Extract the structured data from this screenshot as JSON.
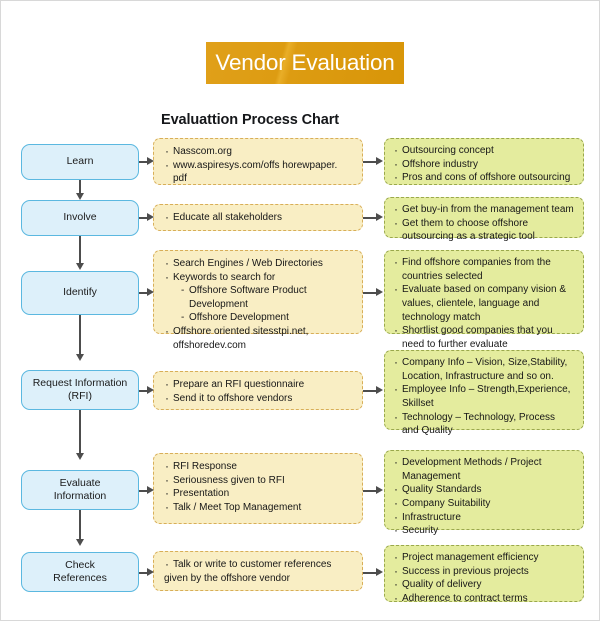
{
  "banner": {
    "title": "Vendor Evaluation",
    "bg_color": "#dd9c12",
    "text_color": "#ffffff"
  },
  "heading": "Evaluattion Process Chart",
  "colors": {
    "stage_fill": "#ddf0fa",
    "stage_border": "#5bb8e0",
    "action_fill": "#f9eec4",
    "action_border": "#d8ae58",
    "outcome_fill": "#e4ec9e",
    "outcome_border": "#9aa84c",
    "connector": "#4d4d4d"
  },
  "rows": [
    {
      "stage": "Learn",
      "actions": [
        "Nasscom.org",
        "www.aspiresys.com/offs horewpaper.",
        "pdf"
      ],
      "outcomes": [
        "Outsourcing concept",
        "Offshore industry",
        "Pros and cons of offshore outsourcing"
      ]
    },
    {
      "stage": "Involve",
      "actions": [
        "Educate all stakeholders"
      ],
      "outcomes": [
        "Get buy-in from the management team",
        "Get them to choose offshore",
        "outsourcing as a strategic tool"
      ]
    },
    {
      "stage": "Identify",
      "actions": [
        "Search Engines / Web Directories",
        "Keywords to search for",
        "Offshore Software Product Development",
        "Offshore Development",
        "Offshore oriented sitesstpi.net,",
        "offshoredev.com"
      ],
      "outcomes": [
        "Find offshore companies from the",
        "countries selected",
        "Evaluate based on company vision &",
        "values, clientele, language and",
        "technology match",
        "Shortlist good companies that you",
        "need to further evaluate"
      ]
    },
    {
      "stage": "Request Information\n(RFI)",
      "stage_line1": "Request Information",
      "stage_line2": "(RFI)",
      "actions": [
        "Prepare an RFI questionnaire",
        "Send it to offshore vendors"
      ],
      "outcomes": [
        "Company Info – Vision, Size,Stability,",
        "Location, Infrastructure and so on.",
        "Employee Info – Strength,Experience,",
        "Skillset",
        "Technology – Technology, Process",
        "and Quality"
      ]
    },
    {
      "stage_line1": "Evaluate",
      "stage_line2": "Information",
      "actions": [
        "RFI Response",
        "Seriousness given to RFI",
        "Presentation",
        "Talk / Meet Top Management"
      ],
      "outcomes": [
        "Development Methods / Project",
        "Management",
        "Quality Standards",
        "Company Suitability",
        "Infrastructure",
        "Security"
      ]
    },
    {
      "stage_line1": "Check",
      "stage_line2": "References",
      "actions": [
        "Talk or write to customer references",
        "given by the offshore vendor"
      ],
      "outcomes": [
        "Project management efficiency",
        "Success in previous projects",
        "Quality of delivery",
        "Adherence to contract terms"
      ]
    }
  ]
}
